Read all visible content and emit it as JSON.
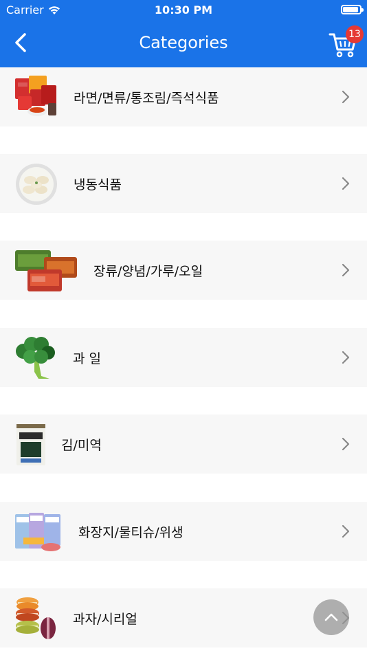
{
  "status_bar": {
    "carrier": "Carrier",
    "time": "10:30 PM"
  },
  "nav": {
    "title": "Categories",
    "cart_count": "13"
  },
  "categories": [
    {
      "label": "라면/면류/통조림/즉석식품",
      "icon": "ramen-products-image"
    },
    {
      "label": "냉동식품",
      "icon": "dumplings-plate-image"
    },
    {
      "label": "장류/양념/가루/오일",
      "icon": "paste-containers-image"
    },
    {
      "label": "과 일",
      "icon": "broccoli-image"
    },
    {
      "label": "김/미역",
      "icon": "seaweed-pack-image"
    },
    {
      "label": "화장지/물티슈/위생",
      "icon": "tissue-packs-image"
    },
    {
      "label": "과자/시리얼",
      "icon": "macarons-image"
    }
  ],
  "colors": {
    "header": "#1a73e8",
    "row_bg": "#f7f7f7",
    "badge": "#e53935"
  }
}
